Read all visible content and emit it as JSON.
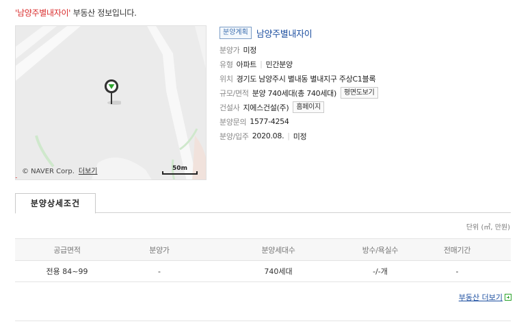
{
  "headline": {
    "quoted_name": "'남양주별내자이'",
    "suffix": " 부동산 정보입니다."
  },
  "map": {
    "credit": "© NAVER Corp.",
    "more_label": "더보기",
    "scale_label": "50m"
  },
  "info": {
    "badge": "분양계획",
    "name": "남양주별내자이",
    "rows": {
      "price": {
        "label": "분양가",
        "value": "미정"
      },
      "type": {
        "label": "유형",
        "value1": "아파트",
        "value2": "민간분양"
      },
      "location": {
        "label": "위치",
        "value": "경기도 남양주시 별내동 별내지구 주상C1블록"
      },
      "size": {
        "label": "규모/면적",
        "value": "분양 740세대(총 740세대)",
        "button": "평면도보기"
      },
      "builder": {
        "label": "건설사",
        "value": "지에스건설(주)",
        "button": "홈페이지"
      },
      "inquiry": {
        "label": "분양문의",
        "value": "1577-4254"
      },
      "schedule": {
        "label": "분양/입주",
        "value1": "2020.08.",
        "value2": "미정"
      }
    }
  },
  "tab": {
    "label": "분양상세조건"
  },
  "unit_note": "단위 (㎡, 만원)",
  "table": {
    "headers": [
      "공급면적",
      "분양가",
      "분양세대수",
      "방수/욕실수",
      "전매기간"
    ],
    "rows": [
      [
        "전용 84~99",
        "-",
        "740세대",
        "-/-개",
        "-"
      ]
    ]
  },
  "more_link": "부동산 더보기",
  "colors": {
    "highlight": "#d92b2b",
    "link": "#1d4fa0",
    "pin": "#2fa52f"
  }
}
